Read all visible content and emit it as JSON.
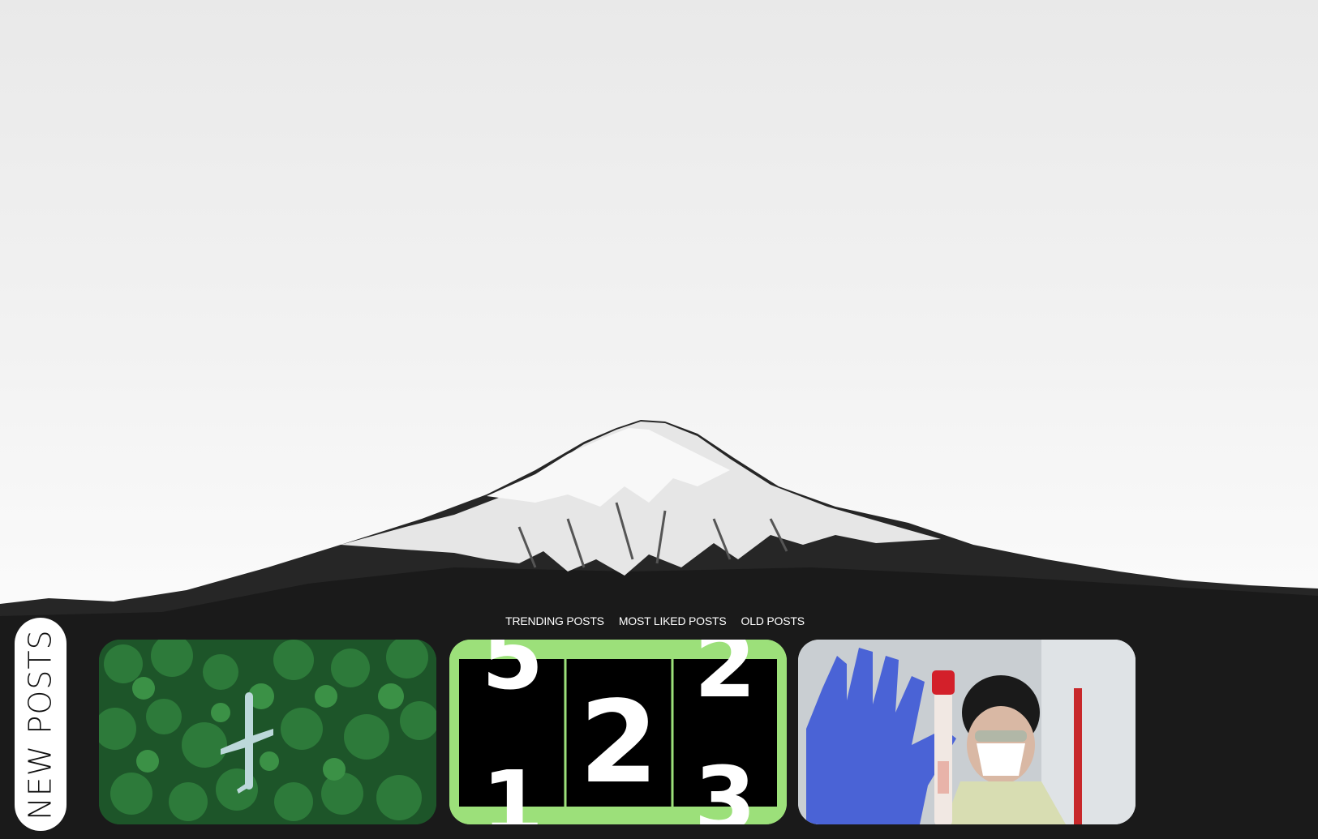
{
  "nav": {
    "items": [
      {
        "label": "TRENDING POSTS"
      },
      {
        "label": "MOST LIKED POSTS"
      },
      {
        "label": "OLD POSTS"
      }
    ]
  },
  "sidebar": {
    "label": "NEW POSTS"
  },
  "cards": [
    {
      "image": "forest-plane-image"
    },
    {
      "image": "number-flip-image"
    },
    {
      "image": "medical-test-image"
    }
  ],
  "colors": {
    "accent_green": "#9ce07a",
    "mountain_dark": "#1a1a1a"
  }
}
